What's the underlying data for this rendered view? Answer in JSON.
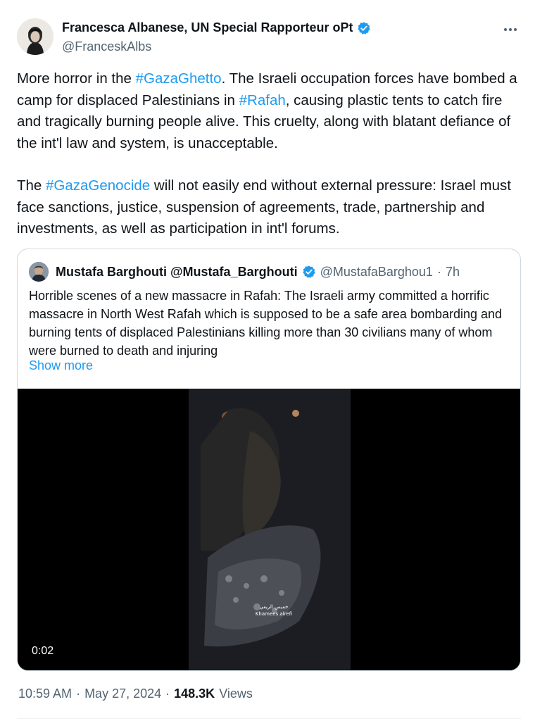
{
  "tweet": {
    "author_name": "Francesca Albanese, UN Special Rapporteur oPt",
    "author_handle": "@FranceskAlbs",
    "paragraph1": {
      "t1": "More horror in the ",
      "tag1": "#GazaGhetto",
      "t2": ". The Israeli occupation forces have bombed a camp for displaced Palestinians in ",
      "tag2": "#Rafah",
      "t3": ", causing plastic tents to catch fire and tragically burning people alive. This cruelty, along with blatant defiance of the int'l law and system, is unacceptable."
    },
    "paragraph2": {
      "t1": "The ",
      "tag1": "#GazaGenocide",
      "t2": " will not easily end without external pressure: Israel must face sanctions, justice, suspension of agreements, trade, partnership and investments, as well as participation in int'l forums."
    },
    "time": "10:59 AM",
    "date": "May 27, 2024",
    "views_count": "148.3K",
    "views_label": "Views"
  },
  "quoted": {
    "author_name": "Mustafa Barghouti @Mustafa_Barghouti",
    "author_handle": "@MustafaBarghou1",
    "age": "7h",
    "text": "Horrible scenes of a new massacre in Rafah:  The Israeli army committed a horrific massacre in North West Rafah which is supposed to be a safe area bombarding and burning tents of displaced Palestinians killing more than 30 civilians many of whom were burned to death and injuring",
    "show_more": "Show more",
    "video_duration": "0:02",
    "video_watermark_arabic": "خميس الريفي",
    "video_watermark": "Khamees.alrefi"
  },
  "colors": {
    "link": "#1d9bf0",
    "verified": "#1d9bf0",
    "secondary_text": "#536471",
    "border": "#cfd9de"
  },
  "icons": [
    "verified-badge-icon",
    "more-options-icon"
  ]
}
